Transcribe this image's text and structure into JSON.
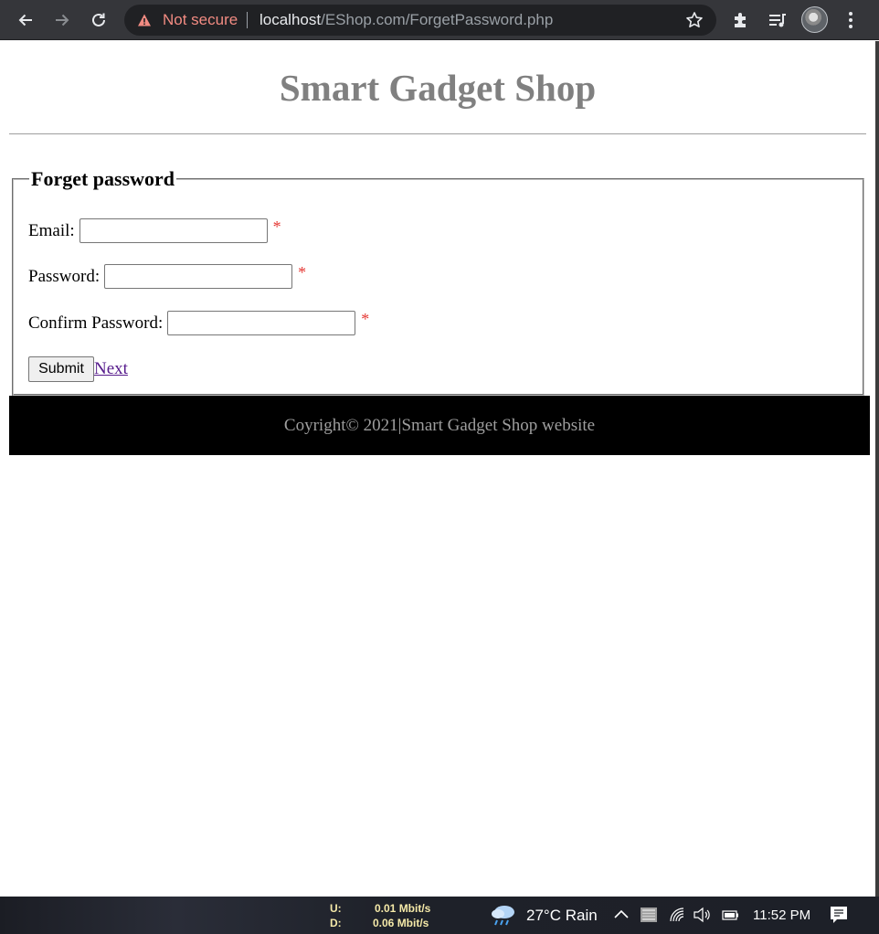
{
  "browser": {
    "security_label": "Not secure",
    "url_host": "localhost",
    "url_path": "/EShop.com/ForgetPassword.php"
  },
  "page": {
    "site_title": "Smart Gadget Shop",
    "form": {
      "legend": "Forget password",
      "fields": [
        {
          "label": "Email:",
          "value": "",
          "required_mark": "*"
        },
        {
          "label": "Password:",
          "value": "",
          "required_mark": "*"
        },
        {
          "label": "Confirm Password:",
          "value": "",
          "required_mark": "*"
        }
      ],
      "submit_label": "Submit",
      "next_link": "Next"
    },
    "footer_text": "Coyright© 2021|Smart Gadget Shop website"
  },
  "taskbar": {
    "upload_label": "U:",
    "download_label": "D:",
    "upload_speed": "0.01 Mbit/s",
    "download_speed": "0.06 Mbit/s",
    "weather": "27°C  Rain",
    "clock": "11:52 PM"
  }
}
